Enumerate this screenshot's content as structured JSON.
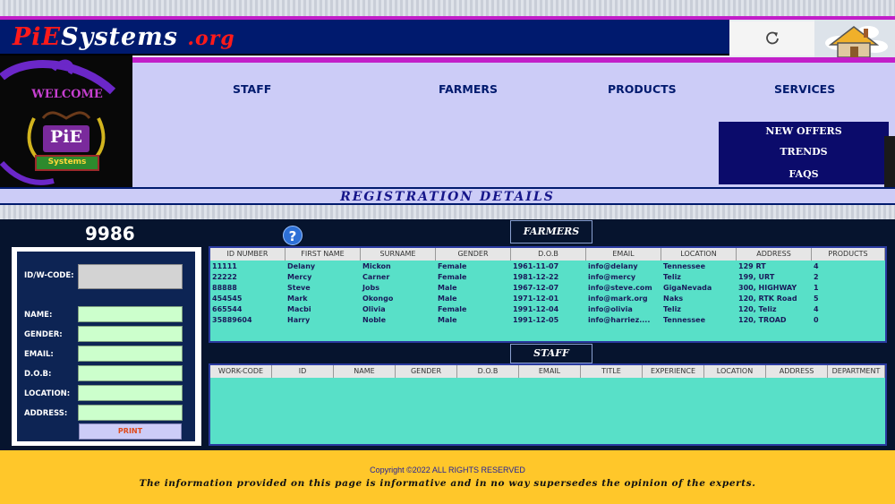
{
  "header": {
    "brand_a": "PiE",
    "brand_b": "Systems",
    "brand_c": ".org"
  },
  "nav": {
    "staff": "STAFF",
    "farmers": "FARMERS",
    "products": "PRODUCTS",
    "services": "SERVICES"
  },
  "logo": {
    "welcome": "WELCOME",
    "pie": "PiE",
    "systems": "Systems"
  },
  "dropdown": {
    "new_offers": "NEW OFFERS",
    "trends": "TRENDS",
    "faqs": "FAQS"
  },
  "registration_title": "REGISTRATION DETAILS",
  "counter": "9986",
  "icons": {
    "refresh": "refresh-icon",
    "home": "home-icon",
    "help": "help-icon",
    "help_glyph": "?"
  },
  "form": {
    "id_label": "ID/W-CODE:",
    "name_label": "NAME:",
    "gender_label": "GENDER:",
    "email_label": "EMAIL:",
    "dob_label": "D.O.B:",
    "location_label": "LOCATION:",
    "address_label": "ADDRESS:",
    "id_value": "",
    "name_value": "",
    "gender_value": "",
    "email_value": "",
    "dob_value": "",
    "location_value": "",
    "address_value": "",
    "print_label": "PRINT"
  },
  "farmers": {
    "title": "FARMERS",
    "columns": [
      "ID NUMBER",
      "FIRST NAME",
      "SURNAME",
      "GENDER",
      "D.O.B",
      "EMAIL",
      "LOCATION",
      "ADDRESS",
      "PRODUCTS"
    ],
    "rows": [
      [
        "11111",
        "Delany",
        "Mickon",
        "Female",
        "1961-11-07",
        "info@delany",
        "Tennessee",
        "129 RT",
        "4"
      ],
      [
        "22222",
        "Mercy",
        "Carner",
        "Female",
        "1981-12-22",
        "info@mercy",
        "Teliz",
        "199, URT",
        "2"
      ],
      [
        "88888",
        "Steve",
        "Jobs",
        "Male",
        "1967-12-07",
        "info@steve.com",
        "GigaNevada",
        "300, HIGHWAY",
        "1"
      ],
      [
        "454545",
        "Mark",
        "Okongo",
        "Male",
        "1971-12-01",
        "info@mark.org",
        "Naks",
        "120, RTK Road",
        "5"
      ],
      [
        "665544",
        "Macbi",
        "Olivia",
        "Female",
        "1991-12-04",
        "info@olivia",
        "Teliz",
        "120, Teliz",
        "4"
      ],
      [
        "35889604",
        "Harry",
        "Noble",
        "Male",
        "1991-12-05",
        "info@harriez....",
        "Tennessee",
        "120, TROAD",
        "0"
      ]
    ]
  },
  "staff": {
    "title": "STAFF",
    "columns": [
      "WORK-CODE",
      "ID",
      "NAME",
      "GENDER",
      "D.O.B",
      "EMAIL",
      "TITLE",
      "EXPERIENCE",
      "LOCATION",
      "ADDRESS",
      "DEPARTMENT"
    ]
  },
  "footer": {
    "copyright": "Copyright ©2022  ALL RIGHTS RESERVED",
    "disclaimer": "The information provided on this page is informative and in no way supersedes the opinion of the experts."
  }
}
